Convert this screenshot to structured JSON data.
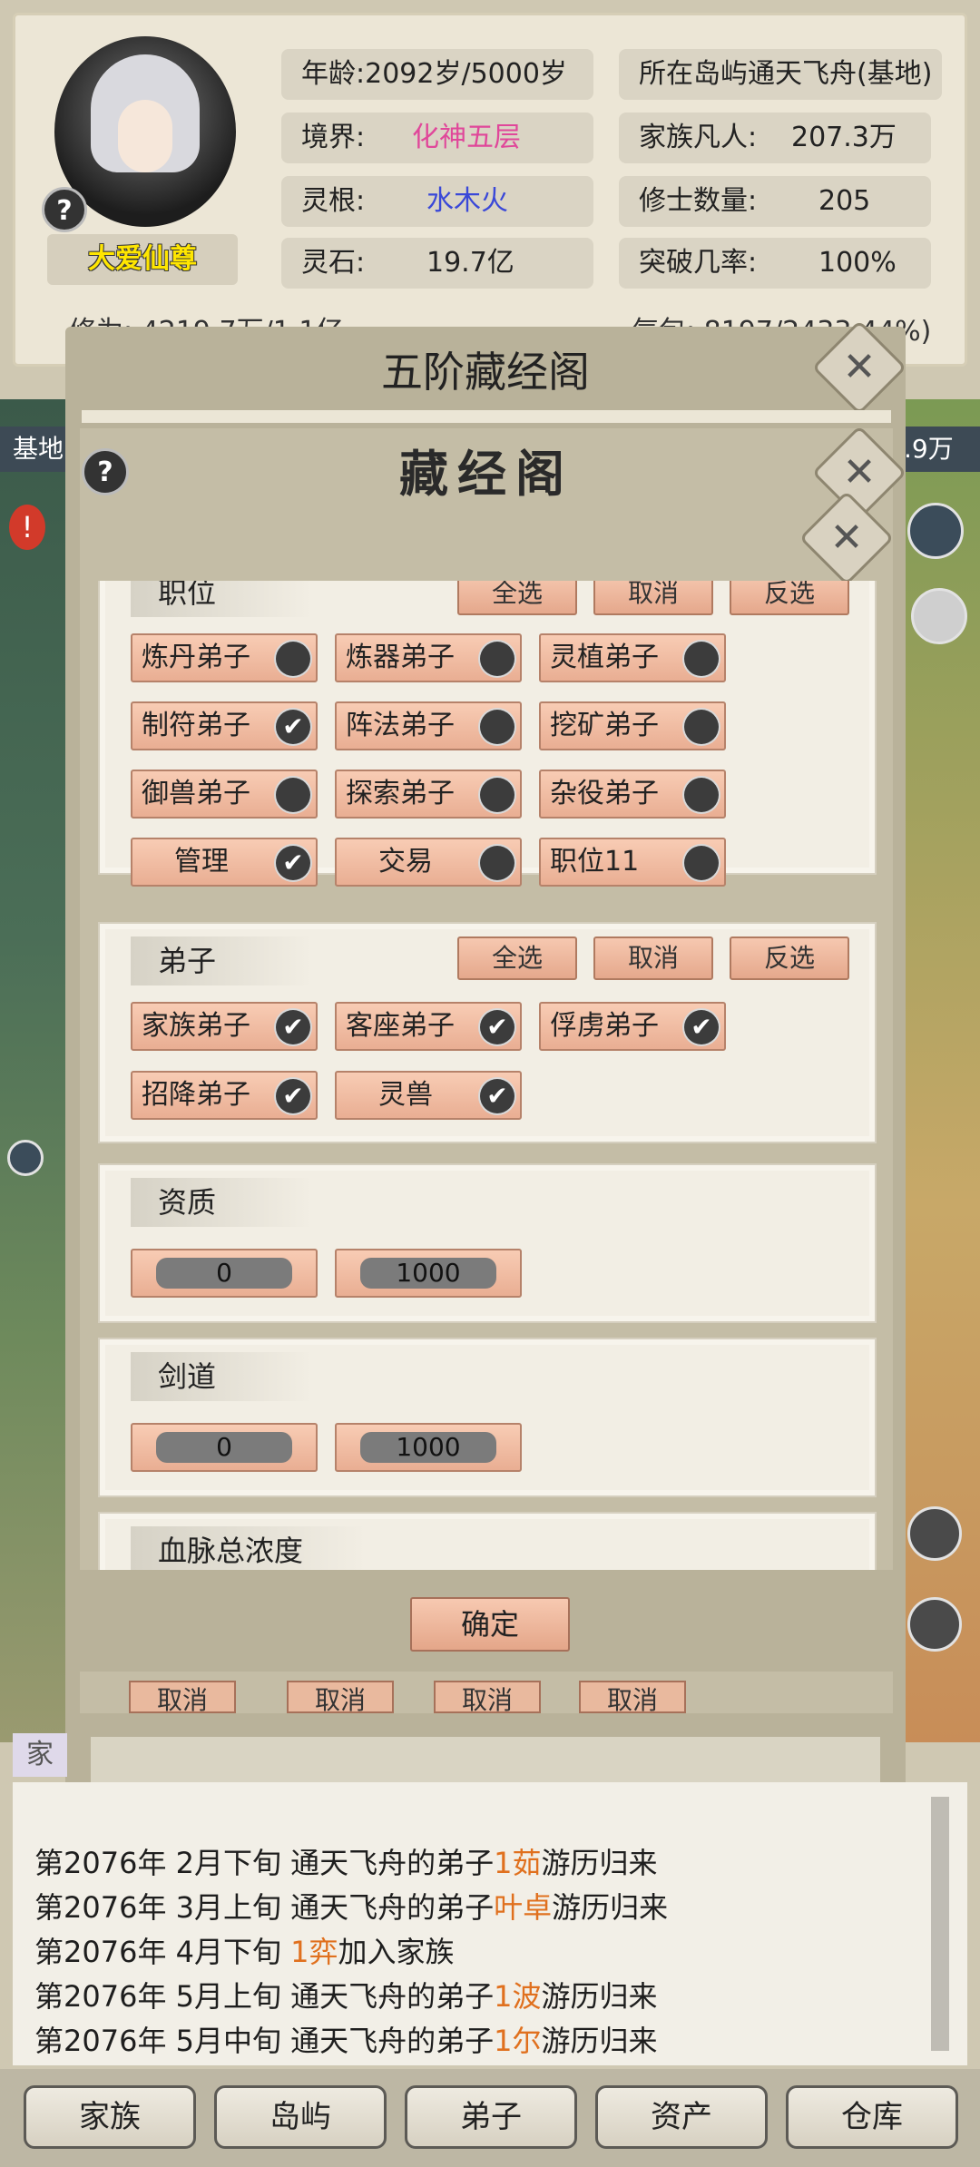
{
  "stats": {
    "age_label": "年龄:",
    "age_value": "2092岁/5000岁",
    "realm_label": "境界:",
    "realm_value": "化神五层",
    "root_label": "灵根:",
    "root_value": "水木火",
    "stone_label": "灵石:",
    "stone_value": "19.7亿",
    "island_label": "所在岛屿",
    "island_value": "通天飞舟(基地)",
    "mortal_label": "家族凡人:",
    "mortal_value": "207.3万",
    "cultivator_label": "修士数量:",
    "cultivator_value": "205",
    "breakthrough_label": "突破几率:",
    "breakthrough_value": "100%",
    "cultivation_partial": "修为:    4219.7万/1.1亿",
    "qi_partial": "气包: 8197/2433 44%)",
    "player_name": "大爱仙尊",
    "help_glyph": "?"
  },
  "map": {
    "left_tag": "基地",
    "right_tag": ".9万"
  },
  "dialog": {
    "title": "五阶藏经阁",
    "inner_title": "藏经阁",
    "help_glyph": "?",
    "close_glyph": "✕",
    "confirm_label": "确定"
  },
  "positions_panel": {
    "title": "职位",
    "select_all": "全选",
    "cancel": "取消",
    "invert": "反选",
    "items": [
      {
        "label": "炼丹弟子",
        "checked": false
      },
      {
        "label": "炼器弟子",
        "checked": false
      },
      {
        "label": "灵植弟子",
        "checked": false
      },
      {
        "label": "制符弟子",
        "checked": true
      },
      {
        "label": "阵法弟子",
        "checked": false
      },
      {
        "label": "挖矿弟子",
        "checked": false
      },
      {
        "label": "御兽弟子",
        "checked": false
      },
      {
        "label": "探索弟子",
        "checked": false
      },
      {
        "label": "杂役弟子",
        "checked": false
      },
      {
        "label": "管理",
        "checked": true
      },
      {
        "label": "交易",
        "checked": false
      },
      {
        "label": "职位11",
        "checked": false
      }
    ]
  },
  "disciples_panel": {
    "title": "弟子",
    "select_all": "全选",
    "cancel": "取消",
    "invert": "反选",
    "items": [
      {
        "label": "家族弟子",
        "checked": true
      },
      {
        "label": "客座弟子",
        "checked": true
      },
      {
        "label": "俘虏弟子",
        "checked": true
      },
      {
        "label": "招降弟子",
        "checked": true
      },
      {
        "label": "灵兽",
        "checked": true
      }
    ]
  },
  "aptitude_panel": {
    "title": "资质",
    "min": "0",
    "max": "1000"
  },
  "sword_panel": {
    "title": "剑道",
    "min": "0",
    "max": "1000"
  },
  "blood_panel": {
    "title": "血脉总浓度"
  },
  "peek_buttons": [
    "取消",
    "取消",
    "取消",
    "取消"
  ],
  "log": [
    {
      "pre": "第2076年 2月下旬 通天飞舟的弟子",
      "hl": "1茹",
      "post": "游历归来"
    },
    {
      "pre": "第2076年 3月上旬 通天飞舟的弟子",
      "hl": "叶卓",
      "post": "游历归来"
    },
    {
      "pre": "第2076年 4月下旬 ",
      "hl": "1弈",
      "post": "加入家族"
    },
    {
      "pre": "第2076年 5月上旬 通天飞舟的弟子",
      "hl": "1波",
      "post": "游历归来"
    },
    {
      "pre": "第2076年 5月中旬 通天飞舟的弟子",
      "hl": "1尔",
      "post": "游历归来"
    }
  ],
  "log_tab": "家",
  "nav": [
    "家族",
    "岛屿",
    "弟子",
    "资产",
    "仓库"
  ],
  "colors": {
    "realm": "#e0479a",
    "root": "#3a48d8",
    "highlight": "#e0701e",
    "name": "#ffe600"
  }
}
